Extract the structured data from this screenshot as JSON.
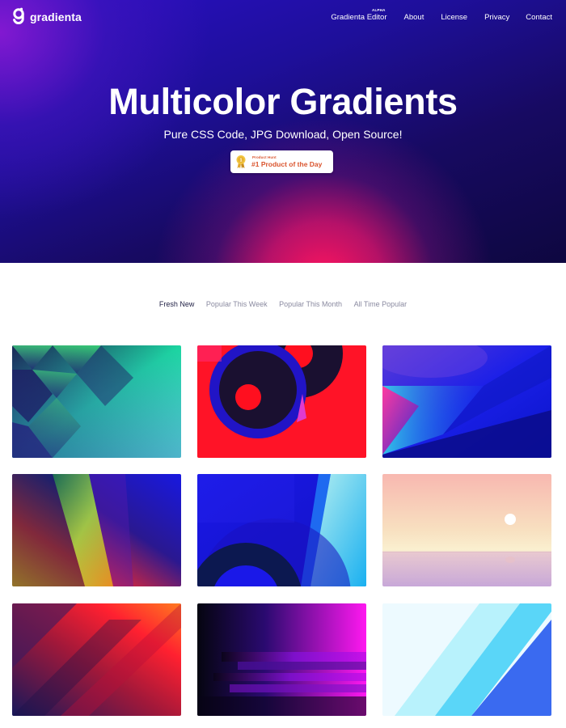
{
  "brand": {
    "name": "gradienta"
  },
  "nav": {
    "editor": "Gradienta Editor",
    "editor_badge": "ALPHA",
    "about": "About",
    "license": "License",
    "privacy": "Privacy",
    "contact": "Contact"
  },
  "hero": {
    "title": "Multicolor Gradients",
    "subtitle": "Pure CSS Code, JPG Download, Open Source!",
    "badge_small": "Product Hunt",
    "badge_big": "#1 Product of the Day"
  },
  "tabs": [
    {
      "label": "Fresh New",
      "active": true
    },
    {
      "label": "Popular This Week",
      "active": false
    },
    {
      "label": "Popular This Month",
      "active": false
    },
    {
      "label": "All Time Popular",
      "active": false
    }
  ],
  "colors": {
    "badge_text": "#da552f",
    "tab_active": "#232347",
    "tab_inactive": "#8a8aa0"
  },
  "icons": [
    "logo-g-icon",
    "medal-icon"
  ]
}
